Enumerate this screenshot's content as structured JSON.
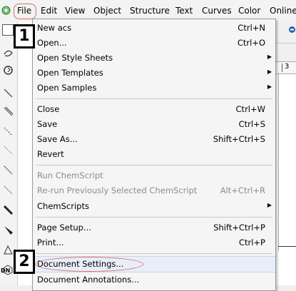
{
  "menubar": {
    "items": [
      "File",
      "Edit",
      "View",
      "Object",
      "Structure",
      "Text",
      "Curves",
      "Color",
      "Online"
    ]
  },
  "file_menu": {
    "items": [
      {
        "label": "New acs",
        "shortcut": "Ctrl+N"
      },
      {
        "label": "Open...",
        "shortcut": "Ctrl+O"
      },
      {
        "label": "Open Style Sheets",
        "shortcut": ""
      },
      {
        "label": "Open Templates",
        "shortcut": ""
      },
      {
        "label": "Open Samples",
        "shortcut": ""
      },
      {
        "label": "Close",
        "shortcut": "Ctrl+W"
      },
      {
        "label": "Save",
        "shortcut": "Ctrl+S"
      },
      {
        "label": "Save As...",
        "shortcut": "Shift+Ctrl+S"
      },
      {
        "label": "Revert",
        "shortcut": ""
      },
      {
        "label": "Run ChemScript",
        "shortcut": ""
      },
      {
        "label": "Re-run Previously Selected ChemScript",
        "shortcut": "Alt+Ctrl+R"
      },
      {
        "label": "ChemScripts",
        "shortcut": ""
      },
      {
        "label": "Page Setup...",
        "shortcut": "Shift+Ctrl+P"
      },
      {
        "label": "Print...",
        "shortcut": "Ctrl+P"
      },
      {
        "label": "Document Settings...",
        "shortcut": ""
      },
      {
        "label": "Document Annotations...",
        "shortcut": ""
      }
    ]
  },
  "badges": [
    "1",
    "2"
  ],
  "ruler_text": "3",
  "status_fragment": "DN",
  "colors": {
    "highlight_oval": "#e06a6a",
    "menu_bg": "#f5f5f5",
    "disabled_text": "#8d8d8d"
  }
}
